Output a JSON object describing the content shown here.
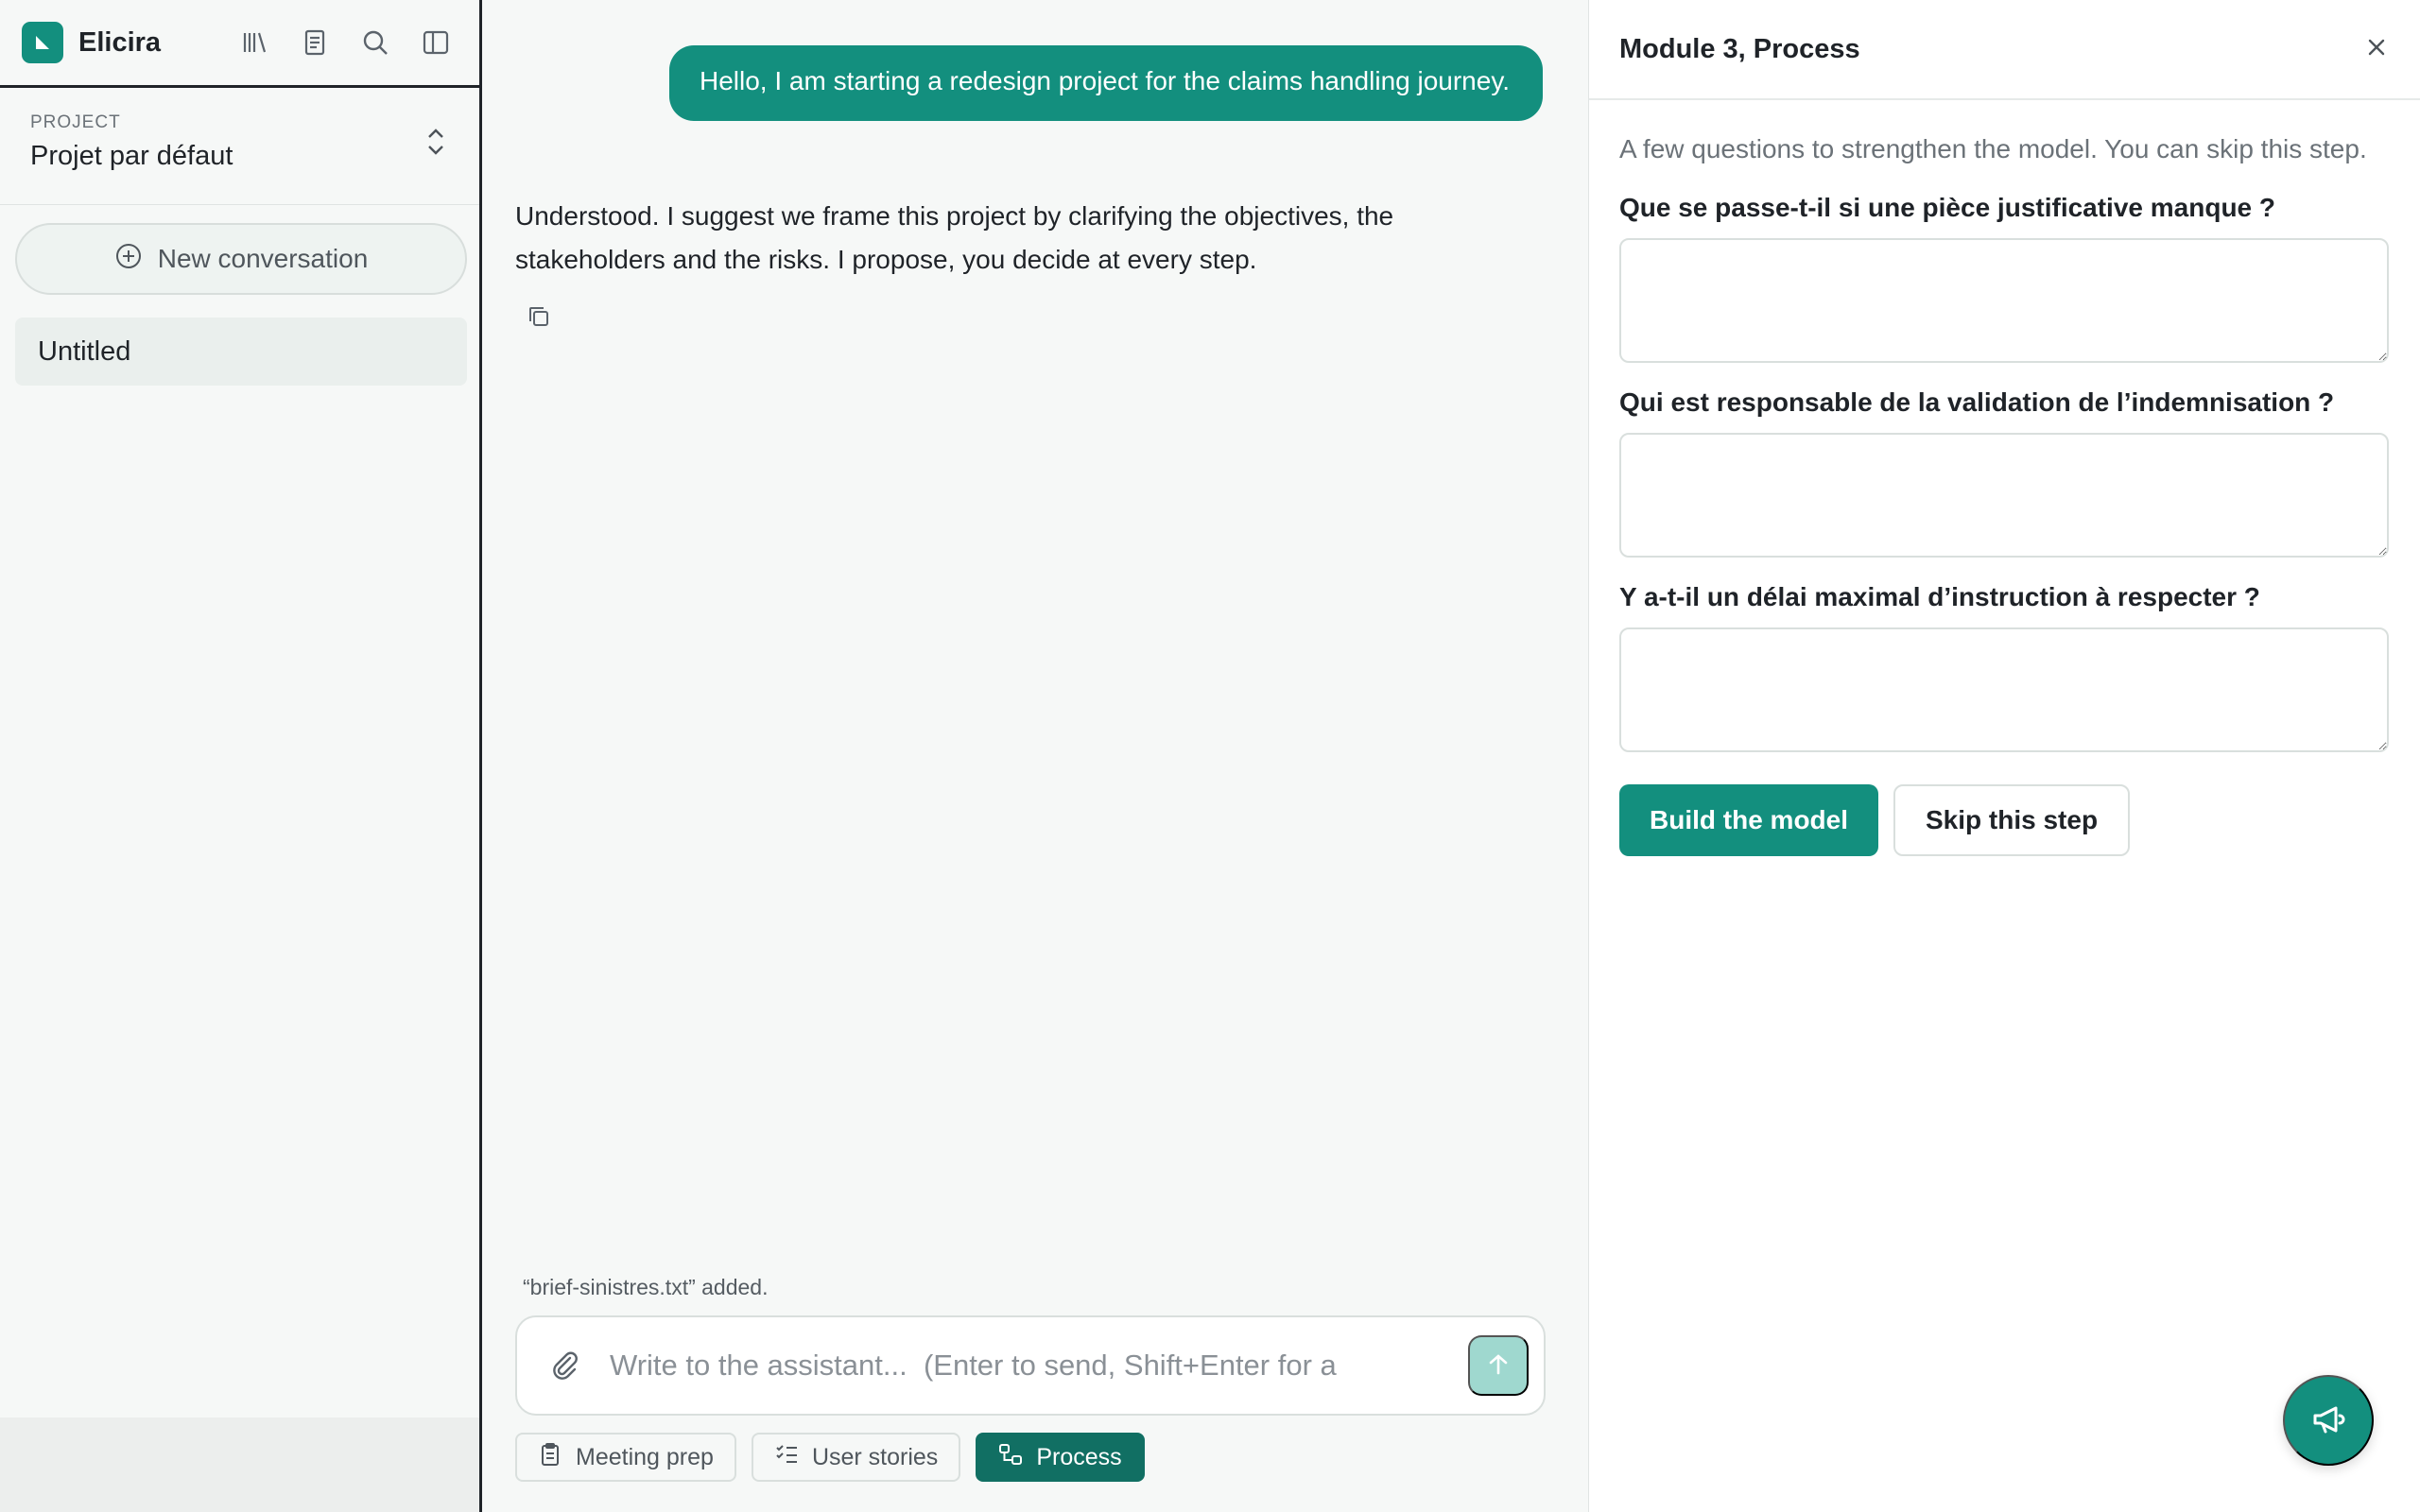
{
  "app": {
    "name": "Elicira"
  },
  "sidebar": {
    "tools": [
      "library-icon",
      "notes-icon",
      "search-icon",
      "sidebar-toggle-icon"
    ],
    "project_label": "PROJECT",
    "project_name": "Projet par défaut",
    "new_conversation_label": "New conversation",
    "conversations": [
      {
        "title": "Untitled"
      }
    ]
  },
  "chat": {
    "user_message": "Hello, I am starting a redesign project for the claims handling journey.",
    "assistant_message": "Understood. I suggest we frame this project by clarifying the objectives, the stakeholders and the risks. I propose, you decide at every step.",
    "upload_note": "“brief-sinistres.txt” added.",
    "composer_placeholder": "Write to the assistant...  (Enter to send, Shift+Enter for a",
    "chips": [
      {
        "label": "Meeting prep",
        "icon": "clipboard-icon",
        "active": false
      },
      {
        "label": "User stories",
        "icon": "checklist-icon",
        "active": false
      },
      {
        "label": "Process",
        "icon": "process-icon",
        "active": true
      }
    ]
  },
  "panel": {
    "title": "Module 3, Process",
    "intro": "A few questions to strengthen the model. You can skip this step.",
    "questions": [
      {
        "label": "Que se passe-t-il si une pièce justificative manque ?"
      },
      {
        "label": "Qui est responsable de la validation de l’indemnisation ?"
      },
      {
        "label": "Y a-t-il un délai maximal d’instruction à respecter ?"
      }
    ],
    "build_label": "Build the model",
    "skip_label": "Skip this step"
  },
  "colors": {
    "accent": "#138f7e",
    "accent_dark": "#116f63",
    "send_disabled": "#9fd8cf"
  }
}
